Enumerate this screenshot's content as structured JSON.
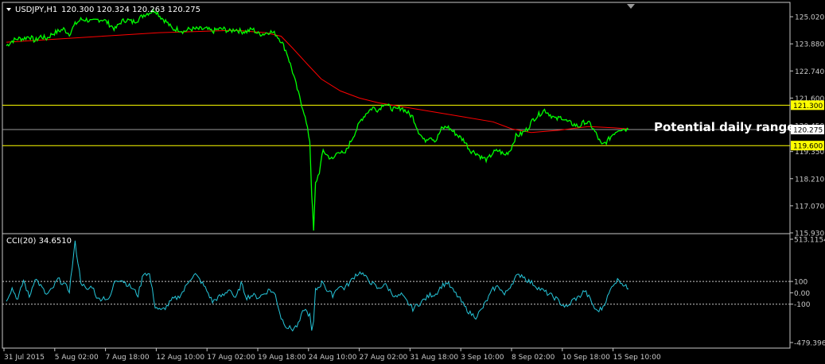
{
  "header": {
    "symbol": "USDJPY,H1",
    "ohlc": "120.300 120.324 120.263 120.275"
  },
  "annotation": "Potential daily range",
  "colors": {
    "price": "#00ff00",
    "ma": "#ff0000",
    "hline": "#ffff00",
    "current_line": "#9a9a9a",
    "cci": "#26c6da",
    "axis": "#c8c8c8",
    "text": "#ffffff",
    "label_bg_yellow": "#ffff00",
    "label_bg_white": "#ffffff"
  },
  "chart_data": [
    {
      "type": "line",
      "name": "USDJPY,H1",
      "y_range": [
        115.93,
        125.59
      ],
      "y_ticks": [
        "125.020",
        "123.880",
        "122.740",
        "121.600",
        "120.450",
        "119.350",
        "118.210",
        "117.070",
        "115.930"
      ],
      "x_ticks": [
        "31 Jul 2015",
        "5 Aug 02:00",
        "7 Aug 18:00",
        "12 Aug 10:00",
        "17 Aug 02:00",
        "19 Aug 18:00",
        "24 Aug 10:00",
        "27 Aug 02:00",
        "31 Aug 18:00",
        "3 Sep 10:00",
        "8 Sep 02:00",
        "10 Sep 18:00",
        "15 Sep 10:00"
      ],
      "price_series": [
        [
          0,
          123.8
        ],
        [
          3,
          124.0
        ],
        [
          6,
          124.1
        ],
        [
          9,
          124.1
        ],
        [
          12,
          124.2
        ],
        [
          15,
          124.0
        ],
        [
          18,
          124.2
        ],
        [
          21,
          124.1
        ],
        [
          24,
          124.3
        ],
        [
          27,
          124.4
        ],
        [
          30,
          124.5
        ],
        [
          33,
          124.3
        ],
        [
          36,
          124.7
        ],
        [
          39,
          124.9
        ],
        [
          42,
          124.9
        ],
        [
          45,
          124.8
        ],
        [
          48,
          124.9
        ],
        [
          51,
          124.9
        ],
        [
          54,
          124.7
        ],
        [
          57,
          124.5
        ],
        [
          60,
          124.8
        ],
        [
          63,
          124.9
        ],
        [
          66,
          124.8
        ],
        [
          69,
          124.9
        ],
        [
          72,
          125.1
        ],
        [
          75,
          125.2
        ],
        [
          78,
          125.3
        ],
        [
          81,
          125.0
        ],
        [
          84,
          124.8
        ],
        [
          87,
          124.5
        ],
        [
          90,
          124.5
        ],
        [
          93,
          124.4
        ],
        [
          96,
          124.5
        ],
        [
          99,
          124.5
        ],
        [
          102,
          124.5
        ],
        [
          105,
          124.5
        ],
        [
          108,
          124.4
        ],
        [
          111,
          124.5
        ],
        [
          114,
          124.5
        ],
        [
          117,
          124.4
        ],
        [
          120,
          124.5
        ],
        [
          123,
          124.4
        ],
        [
          126,
          124.4
        ],
        [
          129,
          124.5
        ],
        [
          132,
          124.3
        ],
        [
          135,
          124.3
        ],
        [
          138,
          124.4
        ],
        [
          141,
          124.3
        ],
        [
          144,
          124.0
        ],
        [
          147,
          123.5
        ],
        [
          150,
          122.7
        ],
        [
          153,
          121.8
        ],
        [
          156,
          121.0
        ],
        [
          159,
          119.8
        ],
        [
          160,
          117.6
        ],
        [
          161,
          116.0
        ],
        [
          162,
          118.0
        ],
        [
          164,
          118.5
        ],
        [
          166,
          119.4
        ],
        [
          168,
          119.2
        ],
        [
          171,
          119.0
        ],
        [
          174,
          119.4
        ],
        [
          177,
          119.2
        ],
        [
          180,
          119.7
        ],
        [
          183,
          120.2
        ],
        [
          186,
          120.7
        ],
        [
          189,
          121.0
        ],
        [
          192,
          121.2
        ],
        [
          195,
          121.1
        ],
        [
          198,
          121.4
        ],
        [
          201,
          121.2
        ],
        [
          204,
          121.1
        ],
        [
          207,
          121.2
        ],
        [
          210,
          121.0
        ],
        [
          213,
          120.8
        ],
        [
          216,
          120.2
        ],
        [
          219,
          119.8
        ],
        [
          222,
          120.0
        ],
        [
          225,
          119.8
        ],
        [
          228,
          120.3
        ],
        [
          231,
          120.4
        ],
        [
          234,
          120.2
        ],
        [
          237,
          120.0
        ],
        [
          240,
          119.8
        ],
        [
          243,
          119.4
        ],
        [
          246,
          119.3
        ],
        [
          249,
          119.1
        ],
        [
          252,
          119.0
        ],
        [
          255,
          119.3
        ],
        [
          258,
          119.4
        ],
        [
          261,
          119.2
        ],
        [
          264,
          119.4
        ],
        [
          267,
          120.0
        ],
        [
          270,
          120.1
        ],
        [
          273,
          120.3
        ],
        [
          276,
          120.7
        ],
        [
          279,
          120.9
        ],
        [
          282,
          121.1
        ],
        [
          285,
          120.9
        ],
        [
          288,
          120.7
        ],
        [
          291,
          120.8
        ],
        [
          294,
          120.6
        ],
        [
          297,
          120.5
        ],
        [
          300,
          120.4
        ],
        [
          303,
          120.6
        ],
        [
          306,
          120.5
        ],
        [
          309,
          120.1
        ],
        [
          312,
          119.6
        ],
        [
          315,
          119.8
        ],
        [
          318,
          120.1
        ],
        [
          321,
          120.3
        ],
        [
          324,
          120.3
        ],
        [
          326,
          120.275
        ]
      ],
      "ma_series": [
        [
          0,
          123.95
        ],
        [
          20,
          124.05
        ],
        [
          40,
          124.15
        ],
        [
          60,
          124.25
        ],
        [
          80,
          124.35
        ],
        [
          100,
          124.4
        ],
        [
          120,
          124.45
        ],
        [
          136,
          124.35
        ],
        [
          144,
          124.2
        ],
        [
          150,
          123.7
        ],
        [
          158,
          123.0
        ],
        [
          165,
          122.4
        ],
        [
          175,
          121.9
        ],
        [
          185,
          121.6
        ],
        [
          195,
          121.4
        ],
        [
          210,
          121.2
        ],
        [
          225,
          121.0
        ],
        [
          240,
          120.8
        ],
        [
          255,
          120.6
        ],
        [
          265,
          120.3
        ],
        [
          275,
          120.15
        ],
        [
          290,
          120.25
        ],
        [
          305,
          120.4
        ],
        [
          318,
          120.35
        ],
        [
          326,
          120.3
        ]
      ],
      "horizontal_lines": [
        {
          "value": 121.3,
          "label": "121.300"
        },
        {
          "value": 119.6,
          "label": "119.600"
        }
      ],
      "current_price": {
        "value": 120.275,
        "label": "120.275"
      }
    },
    {
      "type": "line",
      "name": "CCI(20)",
      "value_label": "CCI(20) 34.6510",
      "y_range": [
        -479.3968,
        513.1154
      ],
      "y_ticks": [
        "513.1154",
        "100",
        "0.00",
        "-100",
        "-479.3968"
      ],
      "levels": [
        100,
        -100
      ],
      "series": [
        [
          0,
          -60
        ],
        [
          3,
          40
        ],
        [
          6,
          -60
        ],
        [
          9,
          110
        ],
        [
          12,
          -40
        ],
        [
          15,
          130
        ],
        [
          18,
          60
        ],
        [
          21,
          -20
        ],
        [
          24,
          30
        ],
        [
          27,
          120
        ],
        [
          30,
          80
        ],
        [
          33,
          20
        ],
        [
          36,
          440
        ],
        [
          39,
          100
        ],
        [
          42,
          20
        ],
        [
          45,
          60
        ],
        [
          48,
          -60
        ],
        [
          51,
          -40
        ],
        [
          54,
          -60
        ],
        [
          57,
          110
        ],
        [
          60,
          120
        ],
        [
          63,
          80
        ],
        [
          66,
          40
        ],
        [
          69,
          -20
        ],
        [
          72,
          180
        ],
        [
          75,
          160
        ],
        [
          78,
          -120
        ],
        [
          81,
          -160
        ],
        [
          84,
          -120
        ],
        [
          87,
          -60
        ],
        [
          90,
          -40
        ],
        [
          93,
          20
        ],
        [
          96,
          120
        ],
        [
          99,
          160
        ],
        [
          102,
          100
        ],
        [
          105,
          20
        ],
        [
          108,
          -80
        ],
        [
          111,
          -40
        ],
        [
          114,
          -20
        ],
        [
          117,
          40
        ],
        [
          120,
          -60
        ],
        [
          123,
          80
        ],
        [
          126,
          -40
        ],
        [
          129,
          -20
        ],
        [
          132,
          -40
        ],
        [
          135,
          -10
        ],
        [
          138,
          30
        ],
        [
          141,
          -20
        ],
        [
          144,
          -220
        ],
        [
          147,
          -300
        ],
        [
          150,
          -320
        ],
        [
          153,
          -280
        ],
        [
          156,
          -140
        ],
        [
          159,
          -200
        ],
        [
          160,
          -340
        ],
        [
          161,
          -260
        ],
        [
          162,
          20
        ],
        [
          164,
          60
        ],
        [
          166,
          100
        ],
        [
          168,
          20
        ],
        [
          171,
          -20
        ],
        [
          174,
          60
        ],
        [
          177,
          40
        ],
        [
          180,
          90
        ],
        [
          183,
          160
        ],
        [
          186,
          180
        ],
        [
          189,
          120
        ],
        [
          192,
          80
        ],
        [
          195,
          30
        ],
        [
          198,
          80
        ],
        [
          201,
          20
        ],
        [
          204,
          -40
        ],
        [
          207,
          -20
        ],
        [
          210,
          -80
        ],
        [
          213,
          -140
        ],
        [
          216,
          -100
        ],
        [
          219,
          -60
        ],
        [
          222,
          -20
        ],
        [
          225,
          -10
        ],
        [
          228,
          60
        ],
        [
          231,
          90
        ],
        [
          234,
          20
        ],
        [
          237,
          -40
        ],
        [
          240,
          -120
        ],
        [
          243,
          -180
        ],
        [
          246,
          -210
        ],
        [
          249,
          -150
        ],
        [
          252,
          -60
        ],
        [
          255,
          30
        ],
        [
          258,
          60
        ],
        [
          261,
          -20
        ],
        [
          264,
          60
        ],
        [
          267,
          140
        ],
        [
          270,
          160
        ],
        [
          273,
          110
        ],
        [
          276,
          80
        ],
        [
          279,
          40
        ],
        [
          282,
          10
        ],
        [
          285,
          -20
        ],
        [
          288,
          -50
        ],
        [
          291,
          -100
        ],
        [
          294,
          -130
        ],
        [
          297,
          -60
        ],
        [
          300,
          -40
        ],
        [
          303,
          20
        ],
        [
          306,
          -60
        ],
        [
          309,
          -160
        ],
        [
          312,
          -140
        ],
        [
          315,
          -40
        ],
        [
          318,
          80
        ],
        [
          321,
          120
        ],
        [
          324,
          60
        ],
        [
          326,
          34.651
        ]
      ]
    }
  ]
}
